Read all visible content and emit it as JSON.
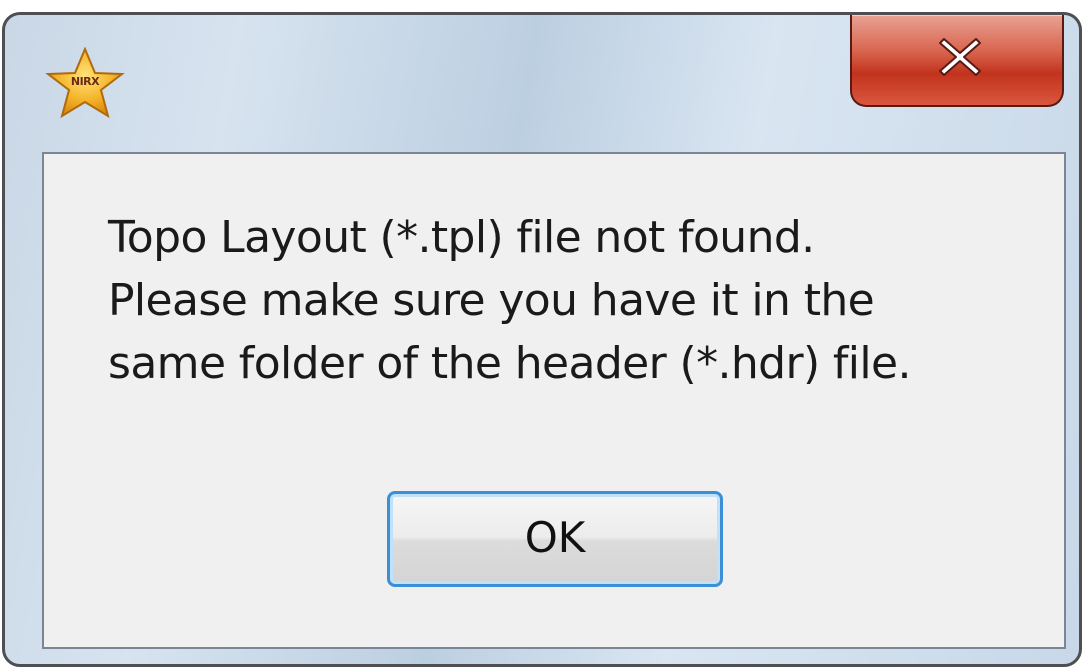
{
  "window": {
    "app_icon": "nrd-star-icon",
    "app_icon_text": "NIRX",
    "close_icon": "close-icon"
  },
  "dialog": {
    "message_lines": [
      "Topo Layout (*.tpl) file not found.",
      "Please make sure you have it in the",
      "same folder of the header (*.hdr) file."
    ],
    "ok_label": "OK"
  },
  "colors": {
    "close_button": "#c7371f",
    "ok_focus_border": "#3c8fd6",
    "dialog_background": "#f0f0f0"
  }
}
